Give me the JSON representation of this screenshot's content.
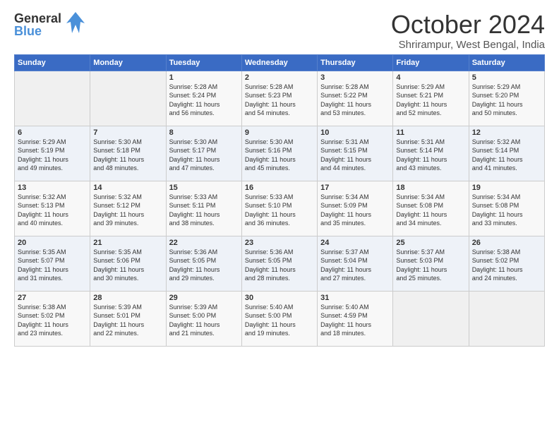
{
  "header": {
    "logo_line1": "General",
    "logo_line2": "Blue",
    "month": "October 2024",
    "location": "Shrirampur, West Bengal, India"
  },
  "weekdays": [
    "Sunday",
    "Monday",
    "Tuesday",
    "Wednesday",
    "Thursday",
    "Friday",
    "Saturday"
  ],
  "weeks": [
    [
      {
        "day": "",
        "info": ""
      },
      {
        "day": "",
        "info": ""
      },
      {
        "day": "1",
        "info": "Sunrise: 5:28 AM\nSunset: 5:24 PM\nDaylight: 11 hours\nand 56 minutes."
      },
      {
        "day": "2",
        "info": "Sunrise: 5:28 AM\nSunset: 5:23 PM\nDaylight: 11 hours\nand 54 minutes."
      },
      {
        "day": "3",
        "info": "Sunrise: 5:28 AM\nSunset: 5:22 PM\nDaylight: 11 hours\nand 53 minutes."
      },
      {
        "day": "4",
        "info": "Sunrise: 5:29 AM\nSunset: 5:21 PM\nDaylight: 11 hours\nand 52 minutes."
      },
      {
        "day": "5",
        "info": "Sunrise: 5:29 AM\nSunset: 5:20 PM\nDaylight: 11 hours\nand 50 minutes."
      }
    ],
    [
      {
        "day": "6",
        "info": "Sunrise: 5:29 AM\nSunset: 5:19 PM\nDaylight: 11 hours\nand 49 minutes."
      },
      {
        "day": "7",
        "info": "Sunrise: 5:30 AM\nSunset: 5:18 PM\nDaylight: 11 hours\nand 48 minutes."
      },
      {
        "day": "8",
        "info": "Sunrise: 5:30 AM\nSunset: 5:17 PM\nDaylight: 11 hours\nand 47 minutes."
      },
      {
        "day": "9",
        "info": "Sunrise: 5:30 AM\nSunset: 5:16 PM\nDaylight: 11 hours\nand 45 minutes."
      },
      {
        "day": "10",
        "info": "Sunrise: 5:31 AM\nSunset: 5:15 PM\nDaylight: 11 hours\nand 44 minutes."
      },
      {
        "day": "11",
        "info": "Sunrise: 5:31 AM\nSunset: 5:14 PM\nDaylight: 11 hours\nand 43 minutes."
      },
      {
        "day": "12",
        "info": "Sunrise: 5:32 AM\nSunset: 5:14 PM\nDaylight: 11 hours\nand 41 minutes."
      }
    ],
    [
      {
        "day": "13",
        "info": "Sunrise: 5:32 AM\nSunset: 5:13 PM\nDaylight: 11 hours\nand 40 minutes."
      },
      {
        "day": "14",
        "info": "Sunrise: 5:32 AM\nSunset: 5:12 PM\nDaylight: 11 hours\nand 39 minutes."
      },
      {
        "day": "15",
        "info": "Sunrise: 5:33 AM\nSunset: 5:11 PM\nDaylight: 11 hours\nand 38 minutes."
      },
      {
        "day": "16",
        "info": "Sunrise: 5:33 AM\nSunset: 5:10 PM\nDaylight: 11 hours\nand 36 minutes."
      },
      {
        "day": "17",
        "info": "Sunrise: 5:34 AM\nSunset: 5:09 PM\nDaylight: 11 hours\nand 35 minutes."
      },
      {
        "day": "18",
        "info": "Sunrise: 5:34 AM\nSunset: 5:08 PM\nDaylight: 11 hours\nand 34 minutes."
      },
      {
        "day": "19",
        "info": "Sunrise: 5:34 AM\nSunset: 5:08 PM\nDaylight: 11 hours\nand 33 minutes."
      }
    ],
    [
      {
        "day": "20",
        "info": "Sunrise: 5:35 AM\nSunset: 5:07 PM\nDaylight: 11 hours\nand 31 minutes."
      },
      {
        "day": "21",
        "info": "Sunrise: 5:35 AM\nSunset: 5:06 PM\nDaylight: 11 hours\nand 30 minutes."
      },
      {
        "day": "22",
        "info": "Sunrise: 5:36 AM\nSunset: 5:05 PM\nDaylight: 11 hours\nand 29 minutes."
      },
      {
        "day": "23",
        "info": "Sunrise: 5:36 AM\nSunset: 5:05 PM\nDaylight: 11 hours\nand 28 minutes."
      },
      {
        "day": "24",
        "info": "Sunrise: 5:37 AM\nSunset: 5:04 PM\nDaylight: 11 hours\nand 27 minutes."
      },
      {
        "day": "25",
        "info": "Sunrise: 5:37 AM\nSunset: 5:03 PM\nDaylight: 11 hours\nand 25 minutes."
      },
      {
        "day": "26",
        "info": "Sunrise: 5:38 AM\nSunset: 5:02 PM\nDaylight: 11 hours\nand 24 minutes."
      }
    ],
    [
      {
        "day": "27",
        "info": "Sunrise: 5:38 AM\nSunset: 5:02 PM\nDaylight: 11 hours\nand 23 minutes."
      },
      {
        "day": "28",
        "info": "Sunrise: 5:39 AM\nSunset: 5:01 PM\nDaylight: 11 hours\nand 22 minutes."
      },
      {
        "day": "29",
        "info": "Sunrise: 5:39 AM\nSunset: 5:00 PM\nDaylight: 11 hours\nand 21 minutes."
      },
      {
        "day": "30",
        "info": "Sunrise: 5:40 AM\nSunset: 5:00 PM\nDaylight: 11 hours\nand 19 minutes."
      },
      {
        "day": "31",
        "info": "Sunrise: 5:40 AM\nSunset: 4:59 PM\nDaylight: 11 hours\nand 18 minutes."
      },
      {
        "day": "",
        "info": ""
      },
      {
        "day": "",
        "info": ""
      }
    ]
  ]
}
